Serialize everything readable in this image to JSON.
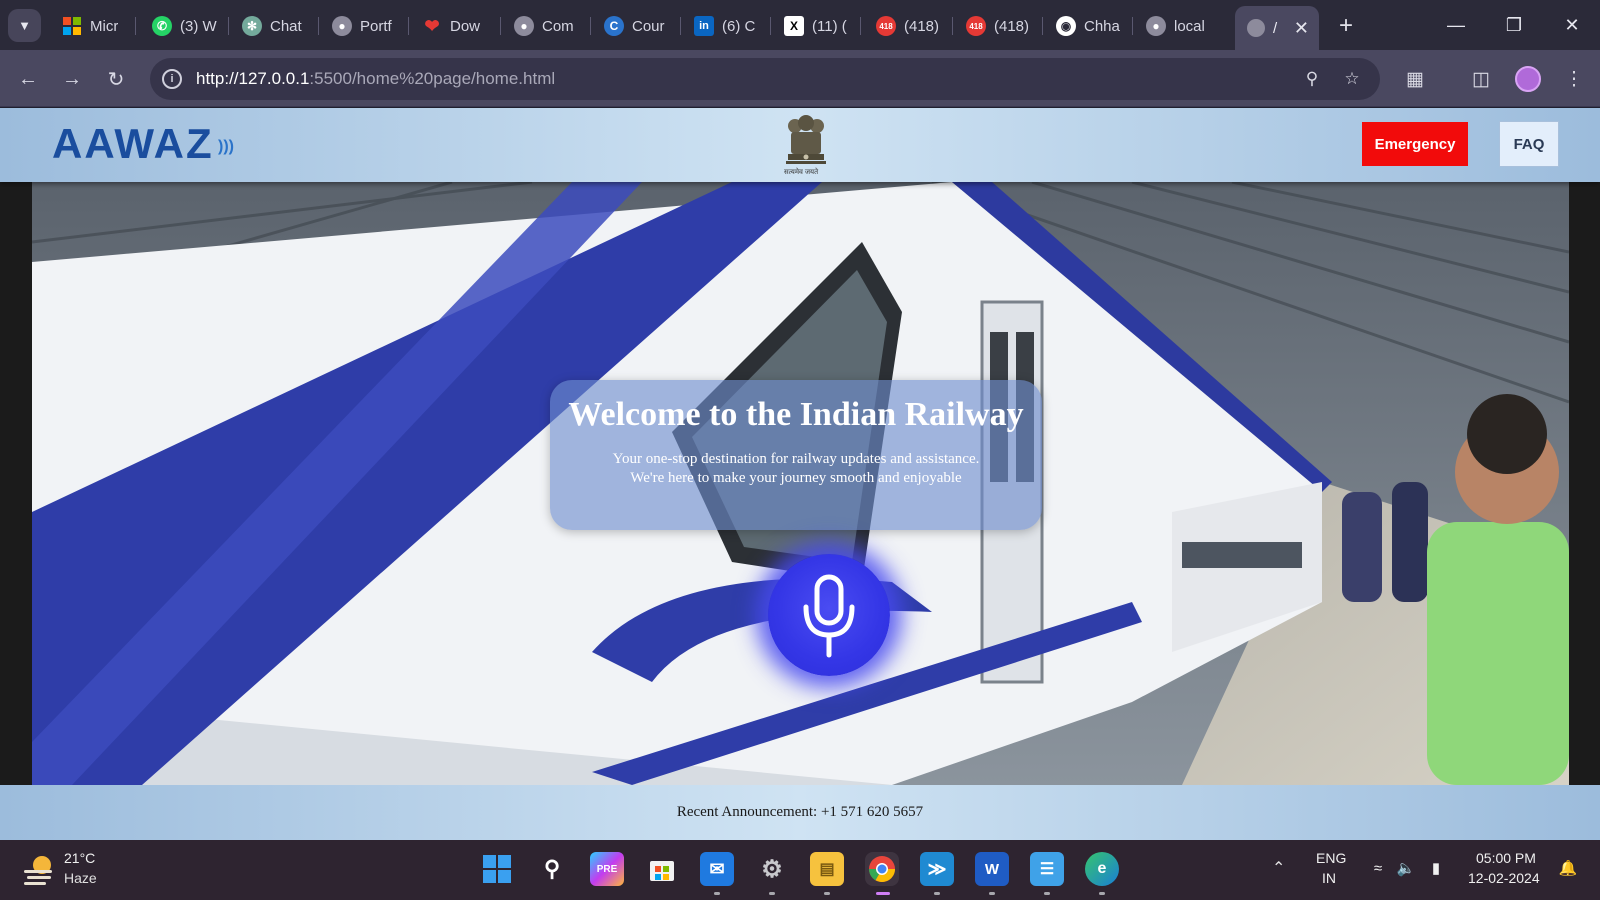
{
  "browser": {
    "tabs": [
      {
        "label": "Micr",
        "icon": "microsoft-icon",
        "color": "#f25022"
      },
      {
        "label": "(3) W",
        "icon": "whatsapp-icon",
        "color": "#25d366"
      },
      {
        "label": "Chat",
        "icon": "chatgpt-icon",
        "color": "#74aa9c"
      },
      {
        "label": "Portf",
        "icon": "globe-icon",
        "color": "#9a9aa8"
      },
      {
        "label": "Dow",
        "icon": "heart-icon",
        "color": "#e53935"
      },
      {
        "label": "Com",
        "icon": "globe-icon",
        "color": "#9a9aa8"
      },
      {
        "label": "Cour",
        "icon": "coursera-icon",
        "color": "#2a73cc"
      },
      {
        "label": "(6) C",
        "icon": "linkedin-icon",
        "color": "#0a66c2"
      },
      {
        "label": "(11) (",
        "icon": "x-icon",
        "color": "#000000"
      },
      {
        "label": "(418)",
        "icon": "notification-418-icon",
        "color": "#e53935"
      },
      {
        "label": "(418)",
        "icon": "notification-418-icon",
        "color": "#e53935"
      },
      {
        "label": "Chha",
        "icon": "github-icon",
        "color": "#ffffff"
      },
      {
        "label": "local",
        "icon": "globe-icon",
        "color": "#9a9aa8"
      }
    ],
    "active_tab": {
      "label": "/",
      "icon": "globe-icon"
    },
    "url_host": "http://127.0.0.1",
    "url_path": ":5500/home%20page/home.html"
  },
  "site": {
    "logo": "AAWAZ",
    "emblem_motto": "सत्यमेव जयते",
    "emergency_label": "Emergency",
    "faq_label": "FAQ",
    "welcome_title": "Welcome to the Indian Railway",
    "welcome_line1": "Your one-stop destination for railway updates and assistance.",
    "welcome_line2": "We're here to make your journey smooth and enjoyable",
    "announcement": "Recent Announcement: +1 571 620 5657",
    "accent_color": "#3436e6",
    "emergency_color": "#f20b0b"
  },
  "taskbar": {
    "weather_temp": "21°C",
    "weather_condition": "Haze",
    "language_line1": "ENG",
    "language_line2": "IN",
    "time": "05:00 PM",
    "date": "12-02-2024",
    "apps": [
      "start-icon",
      "search-icon",
      "copilot-icon",
      "store-icon",
      "mail-icon",
      "settings-icon",
      "file-explorer-icon",
      "chrome-icon",
      "vscode-icon",
      "word-icon",
      "notepad-icon",
      "edge-icon"
    ]
  }
}
